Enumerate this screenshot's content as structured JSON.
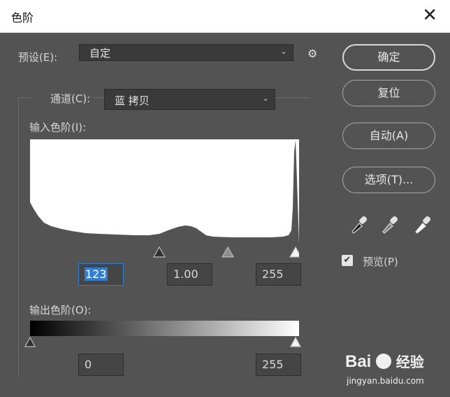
{
  "dialog": {
    "title": "色阶",
    "close_glyph": "✕"
  },
  "preset": {
    "label": "预设(E):",
    "value": "自定",
    "gear": "⚙"
  },
  "channel": {
    "label": "通道(C):",
    "value": "蓝 拷贝"
  },
  "input_levels": {
    "label": "输入色阶(I):",
    "black": "123",
    "gamma": "1.00",
    "white": "255"
  },
  "output_levels": {
    "label": "输出色阶(O):",
    "black": "0",
    "white": "255"
  },
  "buttons": {
    "ok": "确定",
    "reset": "复位",
    "auto": "自动(A)",
    "options": "选项(T)..."
  },
  "preview": {
    "label": "预览(P)",
    "checked": true
  },
  "icons": {
    "chevron": "⌄",
    "check": "✔"
  },
  "watermark": {
    "brand": "Bai",
    "brand_suffix": "经验",
    "url": "jingyan.baidu.com"
  },
  "colors": {
    "dialog_bg": "#535353",
    "histogram_fill": "#535353",
    "selection": "#2f7fd6"
  }
}
